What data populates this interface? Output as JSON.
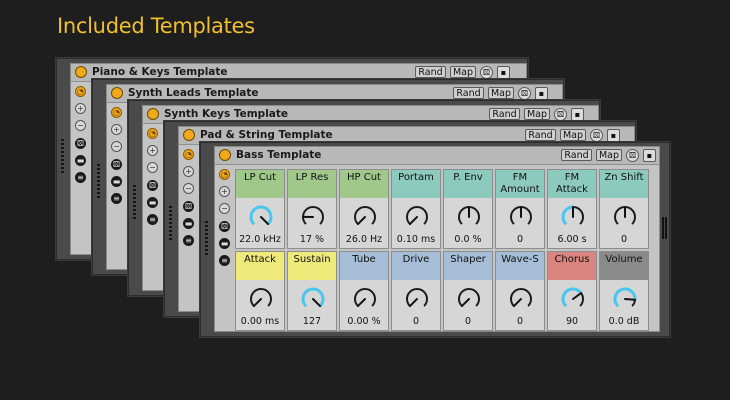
{
  "page": {
    "title": "Included Templates"
  },
  "header_buttons": {
    "rand": "Rand",
    "map": "Map"
  },
  "icons": {
    "power": "power-icon",
    "randomize": "dice-icon",
    "save": "save-icon",
    "plus": "+",
    "minus": "−"
  },
  "colors": {
    "accent": "#f0c02a",
    "power": "#f0a91a",
    "arc": "#47c6ee"
  },
  "templates": [
    {
      "title": "Piano & Keys Template"
    },
    {
      "title": "Synth Leads Template"
    },
    {
      "title": "Synth Keys Template"
    },
    {
      "title": "Pad & String Template"
    },
    {
      "title": "Bass Template"
    }
  ],
  "bass": {
    "row1": [
      {
        "label": "LP Cut",
        "value": "22.0 kHz",
        "color": "#9fc88a",
        "level": 1.0,
        "arc": true
      },
      {
        "label": "LP Res",
        "value": "17 %",
        "color": "#9fc88a",
        "level": 0.17,
        "arc": false
      },
      {
        "label": "HP Cut",
        "value": "26.0 Hz",
        "color": "#9fc88a",
        "level": 0.0,
        "arc": false
      },
      {
        "label": "Portam",
        "value": "0.10 ms",
        "color": "#8ccabd",
        "level": 0.0,
        "arc": false
      },
      {
        "label": "P. Env",
        "value": "0.0 %",
        "color": "#8ccabd",
        "level": 0.5,
        "arc": false
      },
      {
        "label": "FM Amount",
        "value": "0",
        "color": "#8ccabd",
        "level": 0.5,
        "arc": false
      },
      {
        "label": "FM Attack",
        "value": "6.00 s",
        "color": "#8ccabd",
        "level": 0.5,
        "arc": true
      },
      {
        "label": "Zn Shift",
        "value": "0",
        "color": "#8ccabd",
        "level": 0.5,
        "arc": false
      }
    ],
    "row2": [
      {
        "label": "Attack",
        "value": "0.00 ms",
        "color": "#eeea7a",
        "level": 0.0,
        "arc": false
      },
      {
        "label": "Sustain",
        "value": "127",
        "color": "#eeea7a",
        "level": 1.0,
        "arc": true
      },
      {
        "label": "Tube",
        "value": "0.00 %",
        "color": "#a5bdd6",
        "level": 0.0,
        "arc": false
      },
      {
        "label": "Drive",
        "value": "0",
        "color": "#a5bdd6",
        "level": 0.0,
        "arc": false
      },
      {
        "label": "Shaper",
        "value": "0",
        "color": "#a5bdd6",
        "level": 0.0,
        "arc": false
      },
      {
        "label": "Wave-S",
        "value": "0",
        "color": "#a5bdd6",
        "level": 0.0,
        "arc": false
      },
      {
        "label": "Chorus",
        "value": "90",
        "color": "#d9847e",
        "level": 0.7,
        "arc": true
      },
      {
        "label": "Volume",
        "value": "0.0 dB",
        "color": "#8a8a8a",
        "level": 0.85,
        "arc": true
      }
    ]
  }
}
